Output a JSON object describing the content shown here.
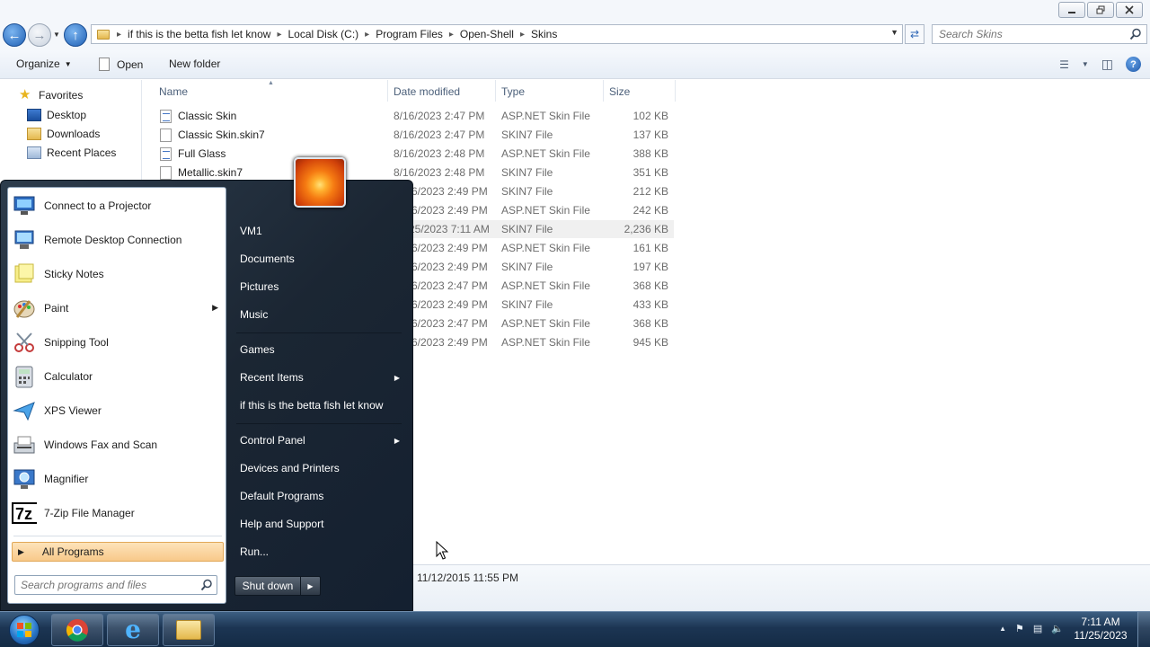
{
  "explorer": {
    "window_controls": [
      "minimize",
      "restore",
      "close"
    ],
    "breadcrumb": [
      "if this is the betta fish let know",
      "Local Disk (C:)",
      "Program Files",
      "Open-Shell",
      "Skins"
    ],
    "search_placeholder": "Search Skins",
    "commands": {
      "organize": "Organize",
      "open": "Open",
      "new_folder": "New folder"
    },
    "nav": {
      "favorites": "Favorites",
      "items": [
        "Desktop",
        "Downloads",
        "Recent Places"
      ]
    },
    "columns": {
      "name": "Name",
      "date": "Date modified",
      "type": "Type",
      "size": "Size"
    },
    "files": [
      {
        "name": "Classic Skin",
        "date": "8/16/2023 2:47 PM",
        "type": "ASP.NET Skin File",
        "size": "102 KB",
        "icon": "asp"
      },
      {
        "name": "Classic Skin.skin7",
        "date": "8/16/2023 2:47 PM",
        "type": "SKIN7 File",
        "size": "137 KB",
        "icon": "doc"
      },
      {
        "name": "Full Glass",
        "date": "8/16/2023 2:48 PM",
        "type": "ASP.NET Skin File",
        "size": "388 KB",
        "icon": "asp"
      },
      {
        "name": "Metallic.skin7",
        "date": "8/16/2023 2:48 PM",
        "type": "SKIN7 File",
        "size": "351 KB",
        "icon": "doc"
      },
      {
        "name": "",
        "date": "6/2023 2:49 PM",
        "type": "SKIN7 File",
        "size": "212 KB",
        "icon": "doc"
      },
      {
        "name": "",
        "date": "6/2023 2:49 PM",
        "type": "ASP.NET Skin File",
        "size": "242 KB",
        "icon": "asp"
      },
      {
        "name": "",
        "date": "25/2023 7:11 AM",
        "type": "SKIN7 File",
        "size": "2,236 KB",
        "icon": "doc",
        "highlight": true
      },
      {
        "name": "",
        "date": "6/2023 2:49 PM",
        "type": "ASP.NET Skin File",
        "size": "161 KB",
        "icon": "asp"
      },
      {
        "name": "",
        "date": "6/2023 2:49 PM",
        "type": "SKIN7 File",
        "size": "197 KB",
        "icon": "doc"
      },
      {
        "name": "",
        "date": "6/2023 2:47 PM",
        "type": "ASP.NET Skin File",
        "size": "368 KB",
        "icon": "asp"
      },
      {
        "name": "",
        "date": "6/2023 2:49 PM",
        "type": "SKIN7 File",
        "size": "433 KB",
        "icon": "doc"
      },
      {
        "name": "",
        "date": "6/2023 2:47 PM",
        "type": "ASP.NET Skin File",
        "size": "368 KB",
        "icon": "asp"
      },
      {
        "name": "",
        "date": "6/2023 2:49 PM",
        "type": "ASP.NET Skin File",
        "size": "945 KB",
        "icon": "asp"
      }
    ],
    "details_text": "11/12/2015 11:55 PM"
  },
  "start_menu": {
    "programs": [
      {
        "label": "Connect to a Projector",
        "icon": "projector-icon"
      },
      {
        "label": "Remote Desktop Connection",
        "icon": "remote-desktop-icon"
      },
      {
        "label": "Sticky Notes",
        "icon": "sticky-notes-icon"
      },
      {
        "label": "Paint",
        "icon": "paint-icon",
        "submenu": true
      },
      {
        "label": "Snipping Tool",
        "icon": "scissors-icon"
      },
      {
        "label": "Calculator",
        "icon": "calculator-icon"
      },
      {
        "label": "XPS Viewer",
        "icon": "xps-icon"
      },
      {
        "label": "Windows Fax and Scan",
        "icon": "fax-icon"
      },
      {
        "label": "Magnifier",
        "icon": "magnifier-icon"
      },
      {
        "label": "7-Zip File Manager",
        "icon": "7zip-icon"
      }
    ],
    "all_programs": "All Programs",
    "search_placeholder": "Search programs and files",
    "right_items": {
      "user": "VM1",
      "documents": "Documents",
      "pictures": "Pictures",
      "music": "Music",
      "games": "Games",
      "recent_items": "Recent Items",
      "user_folder": "if this is the betta fish let know",
      "control_panel": "Control Panel",
      "devices": "Devices and Printers",
      "default_programs": "Default Programs",
      "help": "Help and Support",
      "run": "Run..."
    },
    "shutdown": "Shut down"
  },
  "taskbar": {
    "pinned": [
      "chrome-icon",
      "internet-explorer-icon",
      "explorer-icon"
    ],
    "time": "7:11 AM",
    "date": "11/25/2023"
  }
}
